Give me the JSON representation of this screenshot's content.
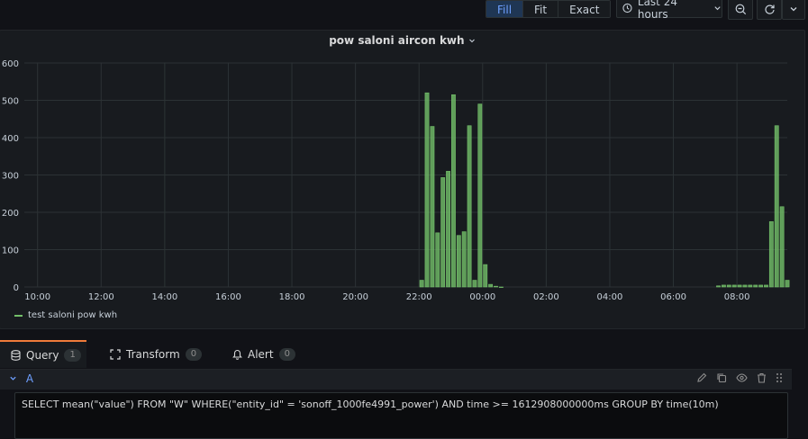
{
  "toolbar": {
    "zoom_modes": [
      "Fill",
      "Fit",
      "Exact"
    ],
    "active_zoom": "Fill",
    "time_range": "Last 24 hours"
  },
  "panel": {
    "title": "pow saloni aircon kwh",
    "legend": "test saloni pow kwh"
  },
  "chart_data": {
    "type": "bar",
    "title": "pow saloni aircon kwh",
    "xlabel": "",
    "ylabel": "",
    "ylim": [
      0,
      600
    ],
    "yticks": [
      0,
      100,
      200,
      300,
      400,
      500,
      600
    ],
    "xticks": [
      "10:00",
      "12:00",
      "14:00",
      "16:00",
      "18:00",
      "20:00",
      "22:00",
      "00:00",
      "02:00",
      "04:00",
      "06:00",
      "08:00"
    ],
    "grid": true,
    "legend_position": "bottom-left",
    "series": [
      {
        "name": "test saloni pow kwh",
        "color": "#73bf69",
        "x": [
          "22:00",
          "22:10",
          "22:20",
          "22:30",
          "22:40",
          "22:50",
          "23:00",
          "23:10",
          "23:20",
          "23:30",
          "23:40",
          "23:50",
          "00:00",
          "00:10",
          "00:20",
          "00:30",
          "07:20",
          "07:30",
          "07:40",
          "07:50",
          "08:00",
          "08:10",
          "08:20",
          "08:30",
          "08:40",
          "08:50",
          "09:00",
          "09:10",
          "09:20",
          "09:30"
        ],
        "values": [
          18,
          520,
          430,
          145,
          293,
          310,
          515,
          138,
          148,
          432,
          18,
          490,
          60,
          7,
          2,
          0,
          3,
          5,
          5,
          5,
          5,
          5,
          5,
          5,
          5,
          5,
          175,
          432,
          215,
          18
        ]
      }
    ]
  },
  "tabs": [
    {
      "label": "Query",
      "count": "1"
    },
    {
      "label": "Transform",
      "count": "0"
    },
    {
      "label": "Alert",
      "count": "0"
    }
  ],
  "query": {
    "ref": "A",
    "text": "SELECT mean(\"value\") FROM \"W\" WHERE(\"entity_id\" = 'sonoff_1000fe4991_power') AND time >= 1612908000000ms GROUP BY time(10m)"
  }
}
